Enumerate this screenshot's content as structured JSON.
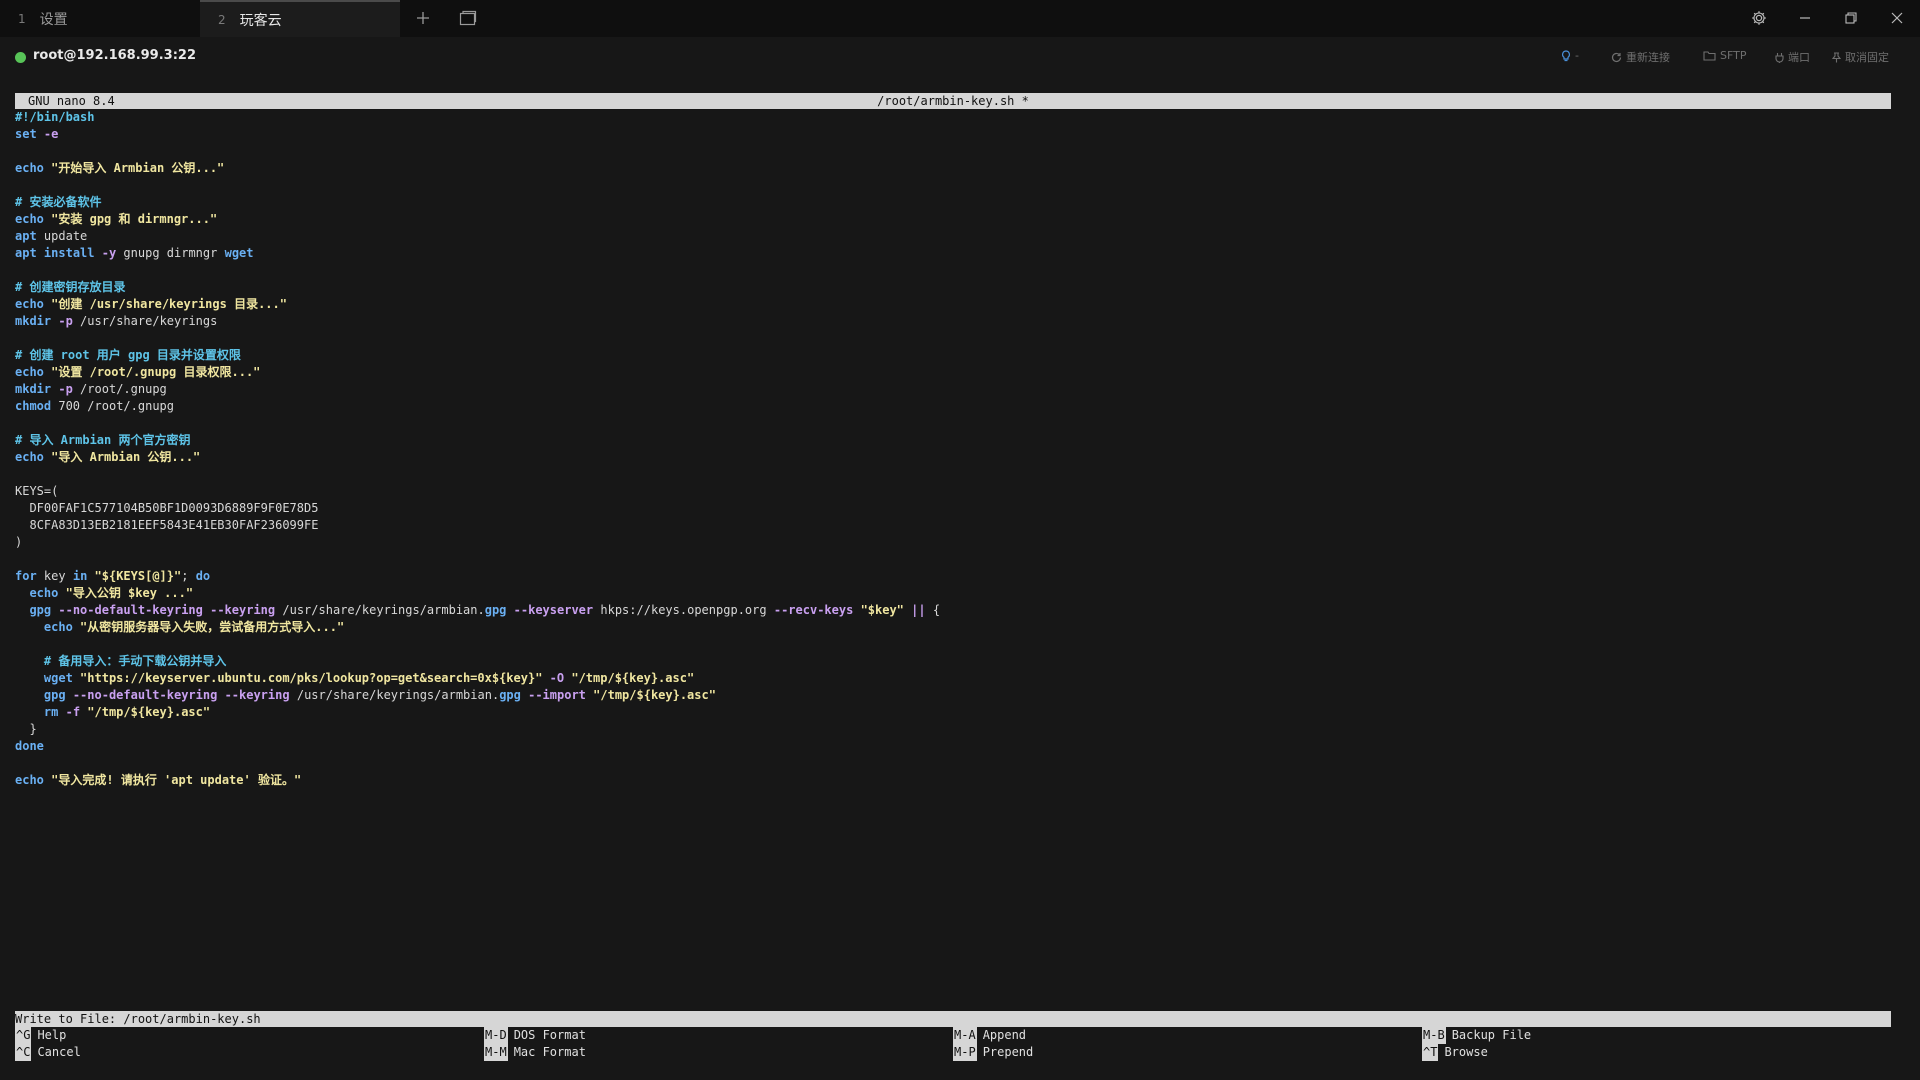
{
  "tabs": [
    {
      "num": "1",
      "label": "设置"
    },
    {
      "num": "2",
      "label": "玩客云"
    }
  ],
  "icons": {
    "add": "plus-icon",
    "window": "window-icon",
    "settings": "gear-icon",
    "minimize": "minimize-icon",
    "restore": "restore-icon",
    "close": "close-icon"
  },
  "host": {
    "label": "root@192.168.99.3:22",
    "status_color": "#58c458"
  },
  "actions": {
    "bulb": "-",
    "reconnect": "重新连接",
    "sftp": "SFTP",
    "port": "端口",
    "unpin": "取消固定"
  },
  "nano": {
    "version": "GNU nano 8.4",
    "filename": "/root/armbin-key.sh *"
  },
  "code_lines": [
    "#!/bin/bash",
    "set -e",
    "",
    "echo \"开始导入 Armbian 公钥...\"",
    "",
    "# 安装必备软件",
    "echo \"安装 gpg 和 dirmngr...\"",
    "apt update",
    "apt install -y gnupg dirmngr wget",
    "",
    "# 创建密钥存放目录",
    "echo \"创建 /usr/share/keyrings 目录...\"",
    "mkdir -p /usr/share/keyrings",
    "",
    "# 创建 root 用户 gpg 目录并设置权限",
    "echo \"设置 /root/.gnupg 目录权限...\"",
    "mkdir -p /root/.gnupg",
    "chmod 700 /root/.gnupg",
    "",
    "# 导入 Armbian 两个官方密钥",
    "echo \"导入 Armbian 公钥...\"",
    "",
    "KEYS=(",
    "  DF00FAF1C577104B50BF1D0093D6889F9F0E78D5",
    "  8CFA83D13EB2181EEF5843E41EB30FAF236099FE",
    ")",
    "",
    "for key in \"${KEYS[@]}\"; do",
    "  echo \"导入公钥 $key ...\"",
    "  gpg --no-default-keyring --keyring /usr/share/keyrings/armbian.gpg --keyserver hkps://keys.openpgp.org --recv-keys \"$key\" || {",
    "    echo \"从密钥服务器导入失败，尝试备用方式导入...\"",
    "",
    "    # 备用导入：手动下载公钥并导入",
    "    wget \"https://keyserver.ubuntu.com/pks/lookup?op=get&search=0x${key}\" -O \"/tmp/${key}.asc\"",
    "    gpg --no-default-keyring --keyring /usr/share/keyrings/armbian.gpg --import \"/tmp/${key}.asc\"",
    "    rm -f \"/tmp/${key}.asc\"",
    "  }",
    "done",
    "",
    "echo \"导入完成! 请执行 'apt update' 验证。\""
  ],
  "status": "Write to File: /root/armbin-key.sh",
  "shortcuts": [
    {
      "key": "^G",
      "label": "Help"
    },
    {
      "key": "M-D",
      "label": "DOS Format"
    },
    {
      "key": "M-A",
      "label": "Append"
    },
    {
      "key": "M-B",
      "label": "Backup File"
    },
    {
      "key": "^C",
      "label": "Cancel"
    },
    {
      "key": "M-M",
      "label": "Mac Format"
    },
    {
      "key": "M-P",
      "label": "Prepend"
    },
    {
      "key": "^T",
      "label": "Browse"
    }
  ]
}
